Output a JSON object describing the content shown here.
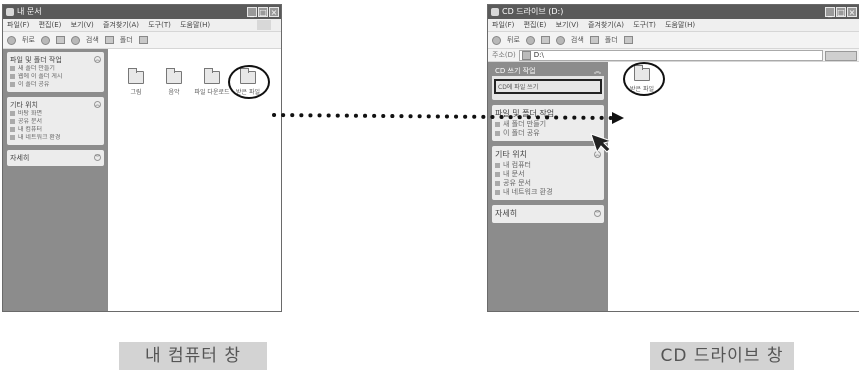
{
  "left_window": {
    "title": "내 문서",
    "menu": [
      "파일(F)",
      "편집(E)",
      "보기(V)",
      "즐겨찾기(A)",
      "도구(T)",
      "도움말(H)"
    ],
    "toolbar": {
      "back": "뒤로",
      "search": "검색",
      "folders": "폴더"
    },
    "tasks_panel": {
      "title": "파일 및 폴더 작업",
      "items": [
        "새 폴더 만들기",
        "웹에 이 폴더 게시",
        "이 폴더 공유"
      ]
    },
    "places_panel": {
      "title": "기타 위치",
      "items": [
        "바탕 화면",
        "공유 문서",
        "내 컴퓨터",
        "내 네트워크 환경"
      ]
    },
    "details_panel": {
      "title": "자세히"
    },
    "folders": [
      "그림",
      "음악",
      "파일 다운로드",
      "받은 파일"
    ]
  },
  "right_window": {
    "title": "CD 드라이브 (D:)",
    "menu": [
      "파일(F)",
      "편집(E)",
      "보기(V)",
      "즐겨찾기(A)",
      "도구(T)",
      "도움말(H)"
    ],
    "toolbar": {
      "back": "뒤로",
      "search": "검색",
      "folders": "폴더"
    },
    "address": {
      "label": "주소(D)",
      "value": "D:\\",
      "go": "이동"
    },
    "cd_panel": {
      "title": "CD 쓰기 작업",
      "item": "CD에 파일 쓰기"
    },
    "tasks_panel": {
      "title": "파일 및 폴더 작업",
      "items": [
        "새 폴더 만들기",
        "이 폴더 공유"
      ]
    },
    "places_panel": {
      "title": "기타 위치",
      "items": [
        "내 컴퓨터",
        "내 문서",
        "공유 문서",
        "내 네트워크 환경"
      ]
    },
    "details_panel": {
      "title": "자세히"
    },
    "folder": "받은 파일"
  },
  "captions": {
    "left": "내 컴퓨터 창",
    "right": "CD 드라이브 창"
  }
}
